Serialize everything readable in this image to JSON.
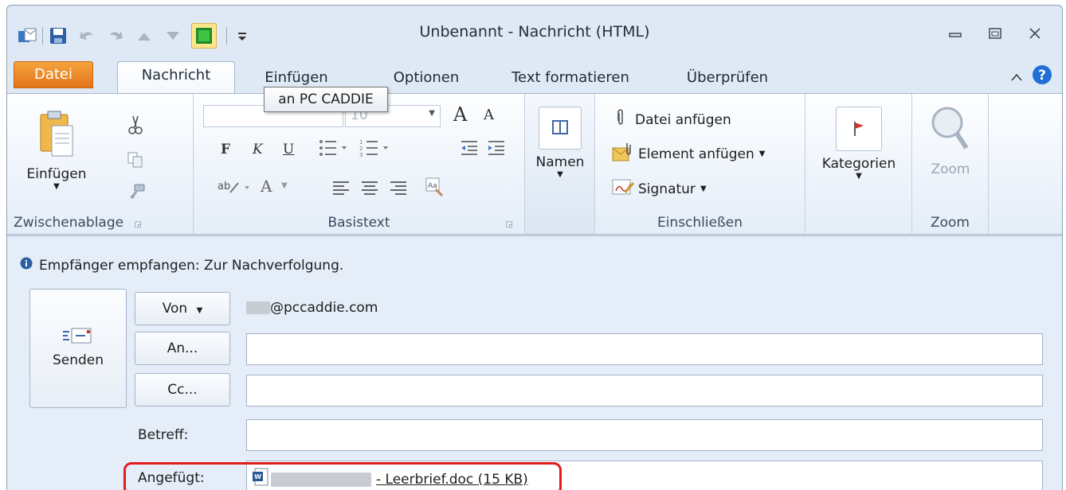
{
  "window": {
    "title": "Unbenannt - Nachricht (HTML)"
  },
  "quick_access": {
    "icons": [
      "outlook-icon",
      "save-icon",
      "undo-icon",
      "redo-icon",
      "up-icon",
      "down-icon",
      "pc-caddie-icon",
      "customize-icon"
    ]
  },
  "tooltip": "an PC CADDIE",
  "tabs": [
    {
      "label": "Datei"
    },
    {
      "label": "Nachricht"
    },
    {
      "label": "Einfügen"
    },
    {
      "label": "Optionen"
    },
    {
      "label": "Text formatieren"
    },
    {
      "label": "Überprüfen"
    }
  ],
  "ribbon": {
    "clipboard": {
      "paste_label": "Einfügen",
      "group_label": "Zwischenablage"
    },
    "basic_text": {
      "font_size": "10",
      "bold": "F",
      "italic": "K",
      "underline": "U",
      "grow_font": "A",
      "shrink_font": "A",
      "font_color": "A",
      "group_label": "Basistext"
    },
    "names": {
      "label": "Namen"
    },
    "include": {
      "attach_file": "Datei anfügen",
      "attach_item": "Element anfügen",
      "signature": "Signatur",
      "group_label": "Einschließen"
    },
    "tags": {
      "categories": "Kategorien"
    },
    "zoom": {
      "label": "Zoom",
      "group_label": "Zoom"
    }
  },
  "message": {
    "info": "Empfänger empfangen: Zur Nachverfolgung.",
    "send_label": "Senden",
    "from_label": "Von",
    "from_value": "@pccaddie.com",
    "to_label": "An...",
    "to_value": "",
    "cc_label": "Cc...",
    "cc_value": "",
    "subject_label": "Betreff:",
    "subject_value": "",
    "attached_label": "Angefügt:",
    "attachment_name": "- Leerbrief.doc (15 KB)"
  },
  "colors": {
    "accent_file_tab": "#e3731a",
    "highlight": "#e21b1b",
    "help": "#1f6fd6"
  }
}
